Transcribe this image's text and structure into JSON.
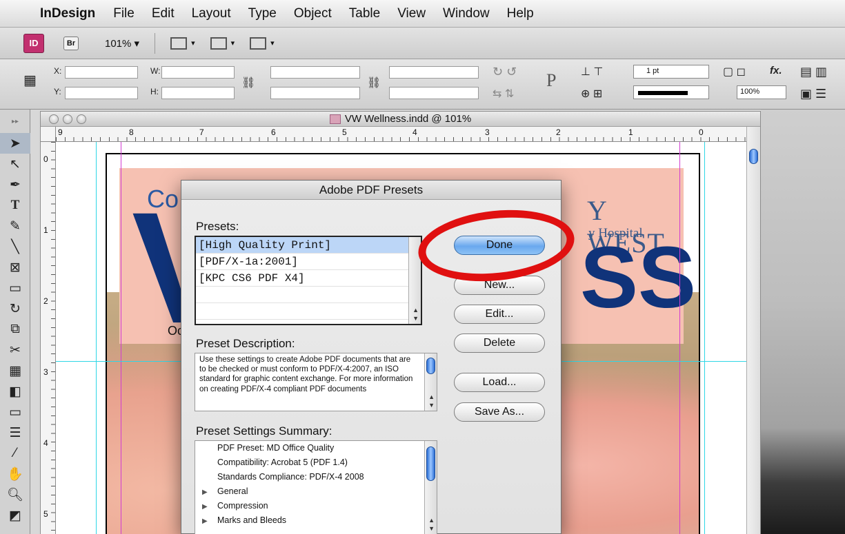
{
  "menubar": {
    "app": "InDesign",
    "items": [
      "File",
      "Edit",
      "Layout",
      "Type",
      "Object",
      "Table",
      "View",
      "Window",
      "Help"
    ]
  },
  "appbar": {
    "id_logo": "ID",
    "br_logo": "Br",
    "zoom": "101% ▾"
  },
  "control": {
    "x_label": "X:",
    "y_label": "Y:",
    "w_label": "W:",
    "h_label": "H:",
    "stroke_weight": "1 pt",
    "opacity": "100%",
    "para_glyph": "P",
    "fx": "fx."
  },
  "document": {
    "title": "VW Wellness.indd @ 101%",
    "hruler_ticks": [
      "9",
      "8",
      "7",
      "6",
      "5",
      "4",
      "3",
      "2",
      "1",
      "0"
    ],
    "vruler_ticks": [
      "0",
      "1",
      "2",
      "3",
      "4",
      "5"
    ],
    "page_text": {
      "com": "Co",
      "big_v": "V",
      "oct": "Oct",
      "west": "Y WEST",
      "hospital": "y Hospital",
      "ss": "SS"
    }
  },
  "dialog": {
    "title": "Adobe PDF Presets",
    "presets_label": "Presets:",
    "presets": [
      "[High Quality Print]",
      "[PDF/X-1a:2001]",
      "[KPC CS6 PDF X4]"
    ],
    "selected_preset": 0,
    "description_label": "Preset Description:",
    "description": "Use these settings to create Adobe PDF documents that are to be checked or must conform to PDF/X-4:2007, an ISO standard for graphic content exchange.  For more information on creating PDF/X-4 compliant PDF documents",
    "summary_label": "Preset Settings Summary:",
    "summary": [
      {
        "text": "PDF Preset: MD Office Quality",
        "expandable": false
      },
      {
        "text": "Compatibility: Acrobat 5 (PDF 1.4)",
        "expandable": false
      },
      {
        "text": "Standards Compliance: PDF/X-4 2008",
        "expandable": false
      },
      {
        "text": "General",
        "expandable": true
      },
      {
        "text": "Compression",
        "expandable": true
      },
      {
        "text": "Marks and Bleeds",
        "expandable": true
      }
    ],
    "buttons": {
      "done": "Done",
      "new": "New...",
      "edit": "Edit...",
      "delete": "Delete",
      "load": "Load...",
      "save_as": "Save As..."
    }
  },
  "colors": {
    "accent": "#2c6fd6",
    "highlight_ring": "#e01010",
    "selection": "#bcd6f7",
    "brand_blue": "#10337a"
  }
}
